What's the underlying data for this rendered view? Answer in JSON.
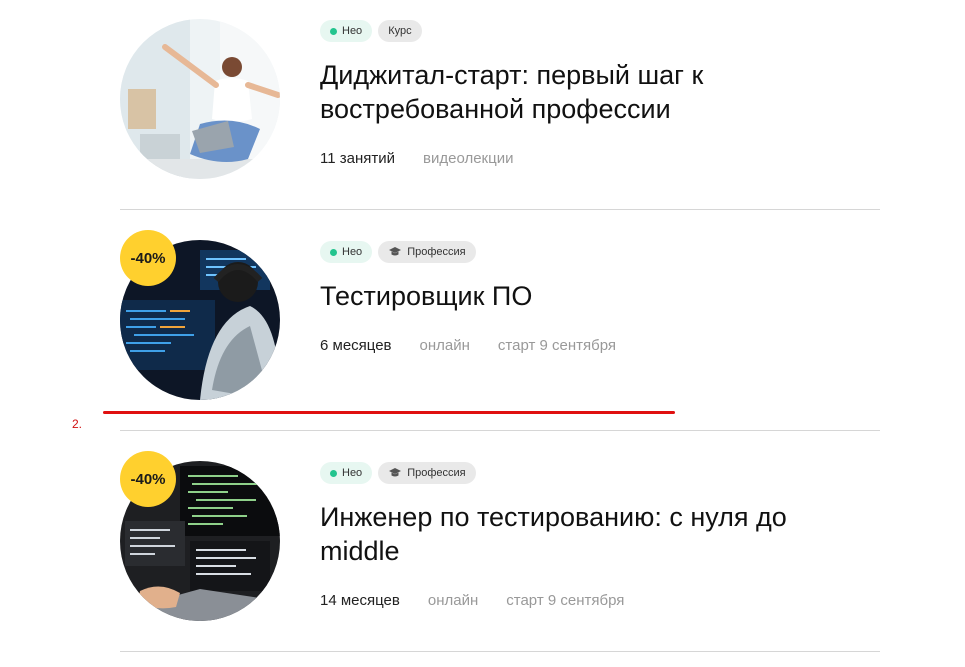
{
  "courses": [
    {
      "badges": {
        "neo": "Нео",
        "type": "Курс",
        "type_icon": ""
      },
      "discount": "",
      "title": "Диджитал-старт: первый шаг к востребованной профессии",
      "meta": {
        "duration": "11 занятий",
        "format": "видеолекции",
        "start": ""
      },
      "image": "woman-with-laptop-photo"
    },
    {
      "badges": {
        "neo": "Нео",
        "type": "Профессия",
        "type_icon": "graduation-cap-icon"
      },
      "discount": "-40%",
      "title": "Тестировщик ПО",
      "meta": {
        "duration": "6 месяцев",
        "format": "онлайн",
        "start": "старт 9 сентября"
      },
      "image": "developer-with-headphones-photo"
    },
    {
      "badges": {
        "neo": "Нео",
        "type": "Профессия",
        "type_icon": "graduation-cap-icon"
      },
      "discount": "-40%",
      "title": "Инженер по тестированию: с нуля до middle",
      "meta": {
        "duration": "14 месяцев",
        "format": "онлайн",
        "start": "старт 9 сентября"
      },
      "image": "laptops-with-code-photo"
    }
  ],
  "annotation": {
    "number": "2.",
    "color": "#e01010"
  },
  "colors": {
    "discount_bg": "#ffd02e",
    "neo_dot": "#23c48e",
    "divider": "#d6d6d6"
  }
}
